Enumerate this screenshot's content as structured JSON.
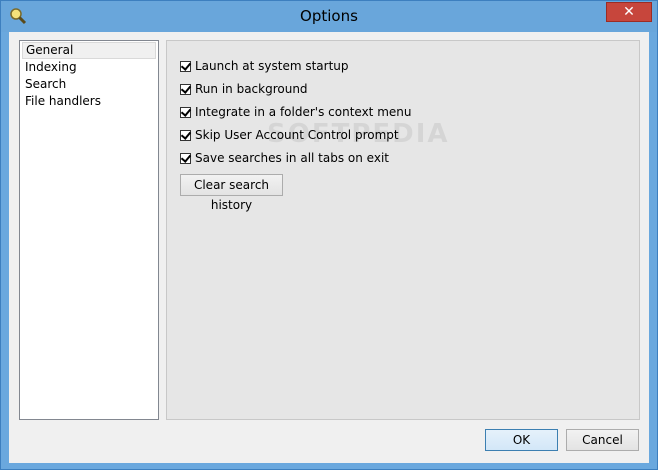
{
  "window": {
    "title": "Options",
    "close_glyph": "✕"
  },
  "sidebar": {
    "items": [
      {
        "label": "General",
        "selected": true
      },
      {
        "label": "Indexing",
        "selected": false
      },
      {
        "label": "Search",
        "selected": false
      },
      {
        "label": "File handlers",
        "selected": false
      }
    ]
  },
  "general": {
    "options": [
      {
        "label": "Launch at system startup",
        "checked": true
      },
      {
        "label": "Run in background",
        "checked": true
      },
      {
        "label": "Integrate in a folder's context menu",
        "checked": true
      },
      {
        "label": "Skip User Account Control prompt",
        "checked": true
      },
      {
        "label": "Save searches in all tabs on exit",
        "checked": true
      }
    ],
    "clear_history_label": "Clear search history"
  },
  "footer": {
    "ok_label": "OK",
    "cancel_label": "Cancel"
  },
  "watermark": "SOFTPEDIA",
  "icons": {
    "app": "magnifier-icon",
    "close": "close-icon",
    "check": "check-icon"
  }
}
